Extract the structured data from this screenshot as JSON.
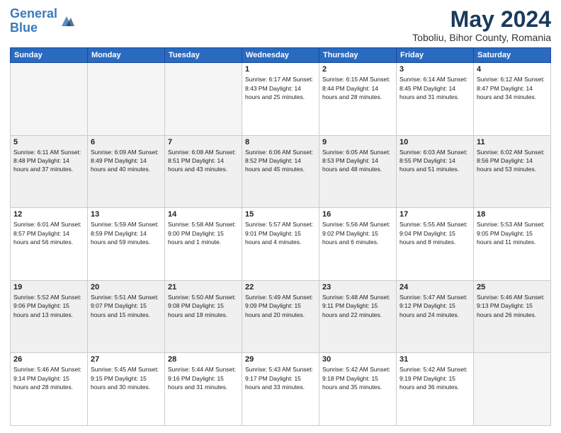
{
  "logo": {
    "line1": "General",
    "line2": "Blue"
  },
  "title": "May 2024",
  "location": "Toboliu, Bihor County, Romania",
  "days_header": [
    "Sunday",
    "Monday",
    "Tuesday",
    "Wednesday",
    "Thursday",
    "Friday",
    "Saturday"
  ],
  "weeks": [
    [
      {
        "num": "",
        "info": ""
      },
      {
        "num": "",
        "info": ""
      },
      {
        "num": "",
        "info": ""
      },
      {
        "num": "1",
        "info": "Sunrise: 6:17 AM\nSunset: 8:43 PM\nDaylight: 14 hours\nand 25 minutes."
      },
      {
        "num": "2",
        "info": "Sunrise: 6:15 AM\nSunset: 8:44 PM\nDaylight: 14 hours\nand 28 minutes."
      },
      {
        "num": "3",
        "info": "Sunrise: 6:14 AM\nSunset: 8:45 PM\nDaylight: 14 hours\nand 31 minutes."
      },
      {
        "num": "4",
        "info": "Sunrise: 6:12 AM\nSunset: 8:47 PM\nDaylight: 14 hours\nand 34 minutes."
      }
    ],
    [
      {
        "num": "5",
        "info": "Sunrise: 6:11 AM\nSunset: 8:48 PM\nDaylight: 14 hours\nand 37 minutes."
      },
      {
        "num": "6",
        "info": "Sunrise: 6:09 AM\nSunset: 8:49 PM\nDaylight: 14 hours\nand 40 minutes."
      },
      {
        "num": "7",
        "info": "Sunrise: 6:08 AM\nSunset: 8:51 PM\nDaylight: 14 hours\nand 43 minutes."
      },
      {
        "num": "8",
        "info": "Sunrise: 6:06 AM\nSunset: 8:52 PM\nDaylight: 14 hours\nand 45 minutes."
      },
      {
        "num": "9",
        "info": "Sunrise: 6:05 AM\nSunset: 8:53 PM\nDaylight: 14 hours\nand 48 minutes."
      },
      {
        "num": "10",
        "info": "Sunrise: 6:03 AM\nSunset: 8:55 PM\nDaylight: 14 hours\nand 51 minutes."
      },
      {
        "num": "11",
        "info": "Sunrise: 6:02 AM\nSunset: 8:56 PM\nDaylight: 14 hours\nand 53 minutes."
      }
    ],
    [
      {
        "num": "12",
        "info": "Sunrise: 6:01 AM\nSunset: 8:57 PM\nDaylight: 14 hours\nand 56 minutes."
      },
      {
        "num": "13",
        "info": "Sunrise: 5:59 AM\nSunset: 8:59 PM\nDaylight: 14 hours\nand 59 minutes."
      },
      {
        "num": "14",
        "info": "Sunrise: 5:58 AM\nSunset: 9:00 PM\nDaylight: 15 hours\nand 1 minute."
      },
      {
        "num": "15",
        "info": "Sunrise: 5:57 AM\nSunset: 9:01 PM\nDaylight: 15 hours\nand 4 minutes."
      },
      {
        "num": "16",
        "info": "Sunrise: 5:56 AM\nSunset: 9:02 PM\nDaylight: 15 hours\nand 6 minutes."
      },
      {
        "num": "17",
        "info": "Sunrise: 5:55 AM\nSunset: 9:04 PM\nDaylight: 15 hours\nand 8 minutes."
      },
      {
        "num": "18",
        "info": "Sunrise: 5:53 AM\nSunset: 9:05 PM\nDaylight: 15 hours\nand 11 minutes."
      }
    ],
    [
      {
        "num": "19",
        "info": "Sunrise: 5:52 AM\nSunset: 9:06 PM\nDaylight: 15 hours\nand 13 minutes."
      },
      {
        "num": "20",
        "info": "Sunrise: 5:51 AM\nSunset: 9:07 PM\nDaylight: 15 hours\nand 15 minutes."
      },
      {
        "num": "21",
        "info": "Sunrise: 5:50 AM\nSunset: 9:08 PM\nDaylight: 15 hours\nand 18 minutes."
      },
      {
        "num": "22",
        "info": "Sunrise: 5:49 AM\nSunset: 9:09 PM\nDaylight: 15 hours\nand 20 minutes."
      },
      {
        "num": "23",
        "info": "Sunrise: 5:48 AM\nSunset: 9:11 PM\nDaylight: 15 hours\nand 22 minutes."
      },
      {
        "num": "24",
        "info": "Sunrise: 5:47 AM\nSunset: 9:12 PM\nDaylight: 15 hours\nand 24 minutes."
      },
      {
        "num": "25",
        "info": "Sunrise: 5:46 AM\nSunset: 9:13 PM\nDaylight: 15 hours\nand 26 minutes."
      }
    ],
    [
      {
        "num": "26",
        "info": "Sunrise: 5:46 AM\nSunset: 9:14 PM\nDaylight: 15 hours\nand 28 minutes."
      },
      {
        "num": "27",
        "info": "Sunrise: 5:45 AM\nSunset: 9:15 PM\nDaylight: 15 hours\nand 30 minutes."
      },
      {
        "num": "28",
        "info": "Sunrise: 5:44 AM\nSunset: 9:16 PM\nDaylight: 15 hours\nand 31 minutes."
      },
      {
        "num": "29",
        "info": "Sunrise: 5:43 AM\nSunset: 9:17 PM\nDaylight: 15 hours\nand 33 minutes."
      },
      {
        "num": "30",
        "info": "Sunrise: 5:42 AM\nSunset: 9:18 PM\nDaylight: 15 hours\nand 35 minutes."
      },
      {
        "num": "31",
        "info": "Sunrise: 5:42 AM\nSunset: 9:19 PM\nDaylight: 15 hours\nand 36 minutes."
      },
      {
        "num": "",
        "info": ""
      }
    ]
  ]
}
